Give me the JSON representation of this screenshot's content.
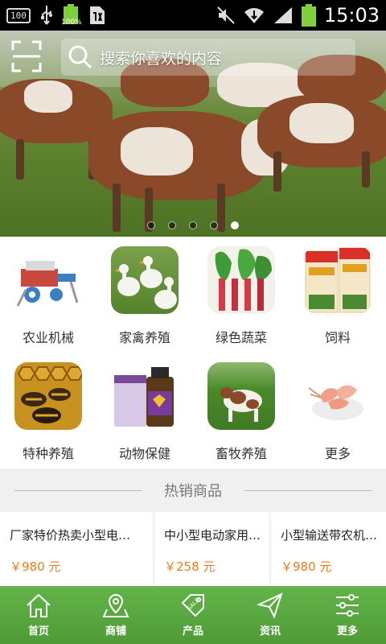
{
  "status_bar": {
    "badge": "100",
    "battery_small_pct": "100%",
    "time": "15:03"
  },
  "search": {
    "placeholder": "搜索你喜欢的内容"
  },
  "banner": {
    "slide_count": 5,
    "active_slide": 5
  },
  "categories": [
    {
      "label": "农业机械",
      "icon": "farm-machine-image"
    },
    {
      "label": "家禽养殖",
      "icon": "geese-image"
    },
    {
      "label": "绿色蔬菜",
      "icon": "vegetables-image"
    },
    {
      "label": "饲料",
      "icon": "feed-bags-image"
    },
    {
      "label": "特种养殖",
      "icon": "bees-image"
    },
    {
      "label": "动物保健",
      "icon": "medicine-image"
    },
    {
      "label": "畜牧养殖",
      "icon": "cow-image"
    },
    {
      "label": "更多",
      "icon": "shrimp-image"
    }
  ],
  "hot_section": {
    "title": "热销商品"
  },
  "products": [
    {
      "title": "厂家特价热卖小型电…",
      "price": "￥980 元"
    },
    {
      "title": "中小型电动家用…",
      "price": "￥258 元"
    },
    {
      "title": "小型输送带农机…",
      "price": "￥980 元"
    }
  ],
  "bottom_nav": [
    {
      "label": "首页",
      "icon": "home-icon"
    },
    {
      "label": "商铺",
      "icon": "map-pin-icon"
    },
    {
      "label": "产品",
      "icon": "sale-tag-icon"
    },
    {
      "label": "资讯",
      "icon": "send-icon"
    },
    {
      "label": "更多",
      "icon": "sliders-icon"
    }
  ],
  "colors": {
    "accent_green": "#5aa83f",
    "price_orange": "#f07a1e"
  }
}
